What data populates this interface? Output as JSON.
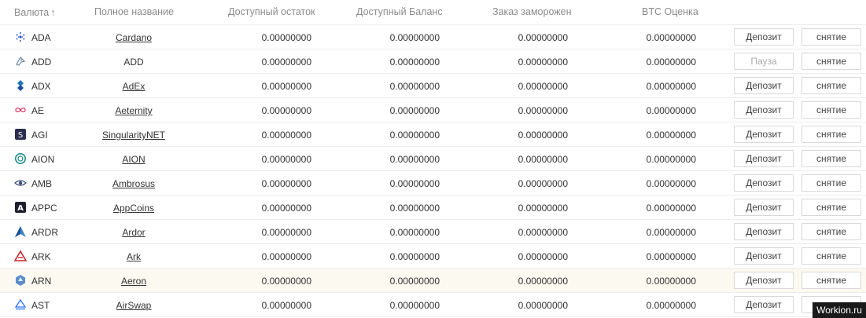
{
  "header": {
    "currency": "Валюта",
    "full_name": "Полное название",
    "available_remaining": "Доступный остаток",
    "available_balance": "Доступный Баланс",
    "order_frozen": "Заказ заморожен",
    "btc_estimate": "BTC Оценка"
  },
  "rows": [
    {
      "ticker": "ADA",
      "name": "Cardano",
      "name_link": true,
      "remaining": "0.00000000",
      "balance": "0.00000000",
      "frozen": "0.00000000",
      "btc": "0.00000000",
      "deposit": "Депозит",
      "deposit_enabled": true,
      "withdraw": "снятие",
      "icon": "cardano-icon"
    },
    {
      "ticker": "ADD",
      "name": "ADD",
      "name_link": false,
      "remaining": "0.00000000",
      "balance": "0.00000000",
      "frozen": "0.00000000",
      "btc": "0.00000000",
      "deposit": "Пауза",
      "deposit_enabled": false,
      "withdraw": "снятие",
      "icon": "add-icon"
    },
    {
      "ticker": "ADX",
      "name": "AdEx",
      "name_link": true,
      "remaining": "0.00000000",
      "balance": "0.00000000",
      "frozen": "0.00000000",
      "btc": "0.00000000",
      "deposit": "Депозит",
      "deposit_enabled": true,
      "withdraw": "снятие",
      "icon": "adex-icon"
    },
    {
      "ticker": "AE",
      "name": "Aeternity",
      "name_link": true,
      "remaining": "0.00000000",
      "balance": "0.00000000",
      "frozen": "0.00000000",
      "btc": "0.00000000",
      "deposit": "Депозит",
      "deposit_enabled": true,
      "withdraw": "снятие",
      "icon": "aeternity-icon"
    },
    {
      "ticker": "AGI",
      "name": "SingularityNET",
      "name_link": true,
      "remaining": "0.00000000",
      "balance": "0.00000000",
      "frozen": "0.00000000",
      "btc": "0.00000000",
      "deposit": "Депозит",
      "deposit_enabled": true,
      "withdraw": "снятие",
      "icon": "singularitynet-icon"
    },
    {
      "ticker": "AION",
      "name": "AION",
      "name_link": true,
      "remaining": "0.00000000",
      "balance": "0.00000000",
      "frozen": "0.00000000",
      "btc": "0.00000000",
      "deposit": "Депозит",
      "deposit_enabled": true,
      "withdraw": "снятие",
      "icon": "aion-icon"
    },
    {
      "ticker": "AMB",
      "name": "Ambrosus",
      "name_link": true,
      "remaining": "0.00000000",
      "balance": "0.00000000",
      "frozen": "0.00000000",
      "btc": "0.00000000",
      "deposit": "Депозит",
      "deposit_enabled": true,
      "withdraw": "снятие",
      "icon": "ambrosus-icon"
    },
    {
      "ticker": "APPC",
      "name": "AppCoins",
      "name_link": true,
      "remaining": "0.00000000",
      "balance": "0.00000000",
      "frozen": "0.00000000",
      "btc": "0.00000000",
      "deposit": "Депозит",
      "deposit_enabled": true,
      "withdraw": "снятие",
      "icon": "appcoins-icon"
    },
    {
      "ticker": "ARDR",
      "name": "Ardor",
      "name_link": true,
      "remaining": "0.00000000",
      "balance": "0.00000000",
      "frozen": "0.00000000",
      "btc": "0.00000000",
      "deposit": "Депозит",
      "deposit_enabled": true,
      "withdraw": "снятие",
      "icon": "ardor-icon"
    },
    {
      "ticker": "ARK",
      "name": "Ark",
      "name_link": true,
      "remaining": "0.00000000",
      "balance": "0.00000000",
      "frozen": "0.00000000",
      "btc": "0.00000000",
      "deposit": "Депозит",
      "deposit_enabled": true,
      "withdraw": "снятие",
      "icon": "ark-icon"
    },
    {
      "ticker": "ARN",
      "name": "Aeron",
      "name_link": true,
      "remaining": "0.00000000",
      "balance": "0.00000000",
      "frozen": "0.00000000",
      "btc": "0.00000000",
      "deposit": "Депозит",
      "deposit_enabled": true,
      "withdraw": "снятие",
      "icon": "aeron-icon"
    },
    {
      "ticker": "AST",
      "name": "AirSwap",
      "name_link": true,
      "remaining": "0.00000000",
      "balance": "0.00000000",
      "frozen": "0.00000000",
      "btc": "0.00000000",
      "deposit": "Депозит",
      "deposit_enabled": true,
      "withdraw": "снятие",
      "icon": "airswap-icon"
    }
  ],
  "highlighted_row": "ARN",
  "watermark": "Workion.ru"
}
